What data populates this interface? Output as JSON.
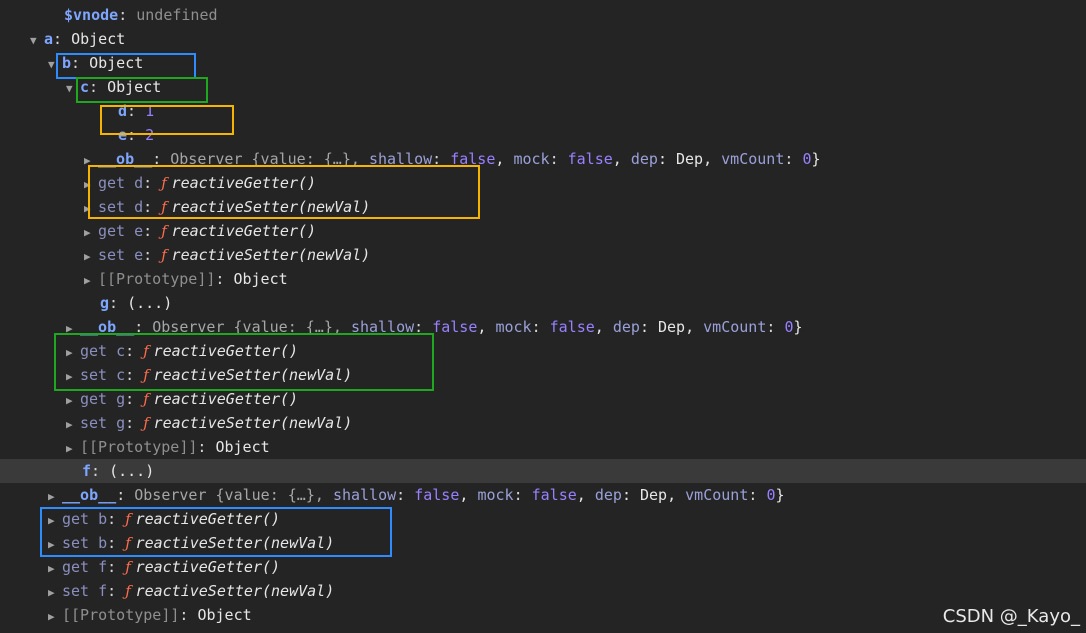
{
  "rows": [
    {
      "indent": 64,
      "tri": "",
      "key": "$vnode",
      "kind": "own",
      "rest": [
        {
          "t": "undefined",
          "c": "undef"
        }
      ]
    },
    {
      "indent": 46,
      "tri": "▼",
      "key": "a",
      "kind": "own",
      "rest": [
        {
          "t": "Object",
          "c": "obj"
        }
      ]
    },
    {
      "indent": 64,
      "tri": "▼",
      "key": "b",
      "kind": "own",
      "rest": [
        {
          "t": "Object",
          "c": "obj"
        }
      ]
    },
    {
      "indent": 82,
      "tri": "▼",
      "key": "c",
      "kind": "own",
      "rest": [
        {
          "t": "Object",
          "c": "obj"
        }
      ]
    },
    {
      "indent": 118,
      "tri": "",
      "key": "d",
      "kind": "own",
      "rest": [
        {
          "t": "1",
          "c": "num"
        }
      ]
    },
    {
      "indent": 118,
      "tri": "",
      "key": "e",
      "kind": "own",
      "rest": [
        {
          "t": "2",
          "c": "num"
        }
      ]
    },
    {
      "indent": 100,
      "tri": "▶",
      "key": "__ob__",
      "kind": "own",
      "rest": [
        {
          "t": "Observer  {value: {…}, ",
          "c": "obsv"
        },
        {
          "t": "shallow",
          "c": "key"
        },
        {
          "t": ": ",
          "c": "colon"
        },
        {
          "t": "false",
          "c": "bool"
        },
        {
          "t": ", ",
          "c": "val"
        },
        {
          "t": "mock",
          "c": "key"
        },
        {
          "t": ": ",
          "c": "colon"
        },
        {
          "t": "false",
          "c": "bool"
        },
        {
          "t": ", ",
          "c": "val"
        },
        {
          "t": "dep",
          "c": "key"
        },
        {
          "t": ": Dep, ",
          "c": "val"
        },
        {
          "t": "vmCount",
          "c": "key"
        },
        {
          "t": ": ",
          "c": "colon"
        },
        {
          "t": "0",
          "c": "num"
        },
        {
          "t": "}",
          "c": "val"
        }
      ]
    },
    {
      "indent": 100,
      "tri": "▶",
      "key": "get d",
      "kind": "dim",
      "rest": [
        {
          "t": "ƒ ",
          "c": "fsym"
        },
        {
          "t": "reactiveGetter()",
          "c": "fname"
        }
      ]
    },
    {
      "indent": 100,
      "tri": "▶",
      "key": "set d",
      "kind": "dim",
      "rest": [
        {
          "t": "ƒ ",
          "c": "fsym"
        },
        {
          "t": "reactiveSetter(newVal)",
          "c": "fname"
        }
      ]
    },
    {
      "indent": 100,
      "tri": "▶",
      "key": "get e",
      "kind": "dim",
      "rest": [
        {
          "t": "ƒ ",
          "c": "fsym"
        },
        {
          "t": "reactiveGetter()",
          "c": "fname"
        }
      ]
    },
    {
      "indent": 100,
      "tri": "▶",
      "key": "set e",
      "kind": "dim",
      "rest": [
        {
          "t": "ƒ ",
          "c": "fsym"
        },
        {
          "t": "reactiveSetter(newVal)",
          "c": "fname"
        }
      ]
    },
    {
      "indent": 100,
      "tri": "▶",
      "key": "[[Prototype]]",
      "kind": "proto",
      "rest": [
        {
          "t": "Object",
          "c": "obj"
        }
      ]
    },
    {
      "indent": 100,
      "tri": "",
      "key": "g",
      "kind": "own",
      "rest": [
        {
          "t": "(...)",
          "c": "lazy"
        }
      ]
    },
    {
      "indent": 82,
      "tri": "▶",
      "key": "__ob__",
      "kind": "own",
      "rest": [
        {
          "t": "Observer  {value: {…}, ",
          "c": "obsv"
        },
        {
          "t": "shallow",
          "c": "key"
        },
        {
          "t": ": ",
          "c": "colon"
        },
        {
          "t": "false",
          "c": "bool"
        },
        {
          "t": ", ",
          "c": "val"
        },
        {
          "t": "mock",
          "c": "key"
        },
        {
          "t": ": ",
          "c": "colon"
        },
        {
          "t": "false",
          "c": "bool"
        },
        {
          "t": ", ",
          "c": "val"
        },
        {
          "t": "dep",
          "c": "key"
        },
        {
          "t": ": Dep, ",
          "c": "val"
        },
        {
          "t": "vmCount",
          "c": "key"
        },
        {
          "t": ": ",
          "c": "colon"
        },
        {
          "t": "0",
          "c": "num"
        },
        {
          "t": "}",
          "c": "val"
        }
      ]
    },
    {
      "indent": 82,
      "tri": "▶",
      "key": "get c",
      "kind": "dim",
      "rest": [
        {
          "t": "ƒ ",
          "c": "fsym"
        },
        {
          "t": "reactiveGetter()",
          "c": "fname"
        }
      ]
    },
    {
      "indent": 82,
      "tri": "▶",
      "key": "set c",
      "kind": "dim",
      "rest": [
        {
          "t": "ƒ ",
          "c": "fsym"
        },
        {
          "t": "reactiveSetter(newVal)",
          "c": "fname"
        }
      ]
    },
    {
      "indent": 82,
      "tri": "▶",
      "key": "get g",
      "kind": "dim",
      "rest": [
        {
          "t": "ƒ ",
          "c": "fsym"
        },
        {
          "t": "reactiveGetter()",
          "c": "fname"
        }
      ]
    },
    {
      "indent": 82,
      "tri": "▶",
      "key": "set g",
      "kind": "dim",
      "rest": [
        {
          "t": "ƒ ",
          "c": "fsym"
        },
        {
          "t": "reactiveSetter(newVal)",
          "c": "fname"
        }
      ]
    },
    {
      "indent": 82,
      "tri": "▶",
      "key": "[[Prototype]]",
      "kind": "proto",
      "rest": [
        {
          "t": "Object",
          "c": "obj"
        }
      ]
    },
    {
      "indent": 82,
      "tri": "",
      "key": "f",
      "kind": "own",
      "hl": true,
      "rest": [
        {
          "t": "(...)",
          "c": "lazy"
        }
      ]
    },
    {
      "indent": 64,
      "tri": "▶",
      "key": "__ob__",
      "kind": "own",
      "rest": [
        {
          "t": "Observer  {value: {…}, ",
          "c": "obsv"
        },
        {
          "t": "shallow",
          "c": "key"
        },
        {
          "t": ": ",
          "c": "colon"
        },
        {
          "t": "false",
          "c": "bool"
        },
        {
          "t": ", ",
          "c": "val"
        },
        {
          "t": "mock",
          "c": "key"
        },
        {
          "t": ": ",
          "c": "colon"
        },
        {
          "t": "false",
          "c": "bool"
        },
        {
          "t": ", ",
          "c": "val"
        },
        {
          "t": "dep",
          "c": "key"
        },
        {
          "t": ": Dep, ",
          "c": "val"
        },
        {
          "t": "vmCount",
          "c": "key"
        },
        {
          "t": ": ",
          "c": "colon"
        },
        {
          "t": "0",
          "c": "num"
        },
        {
          "t": "}",
          "c": "val"
        }
      ]
    },
    {
      "indent": 64,
      "tri": "▶",
      "key": "get b",
      "kind": "dim",
      "rest": [
        {
          "t": "ƒ ",
          "c": "fsym"
        },
        {
          "t": "reactiveGetter()",
          "c": "fname"
        }
      ]
    },
    {
      "indent": 64,
      "tri": "▶",
      "key": "set b",
      "kind": "dim",
      "rest": [
        {
          "t": "ƒ ",
          "c": "fsym"
        },
        {
          "t": "reactiveSetter(newVal)",
          "c": "fname"
        }
      ]
    },
    {
      "indent": 64,
      "tri": "▶",
      "key": "get f",
      "kind": "dim",
      "rest": [
        {
          "t": "ƒ ",
          "c": "fsym"
        },
        {
          "t": "reactiveGetter()",
          "c": "fname"
        }
      ]
    },
    {
      "indent": 64,
      "tri": "▶",
      "key": "set f",
      "kind": "dim",
      "rest": [
        {
          "t": "ƒ ",
          "c": "fsym"
        },
        {
          "t": "reactiveSetter(newVal)",
          "c": "fname"
        }
      ]
    },
    {
      "indent": 64,
      "tri": "▶",
      "key": "[[Prototype]]",
      "kind": "proto",
      "rest": [
        {
          "t": "Object",
          "c": "obj"
        }
      ]
    }
  ],
  "watermark": "CSDN @_Kayo_",
  "colors": {
    "blue_box": "#2f8cff",
    "green_box": "#1fa81f",
    "yellow_box": "#f5b400",
    "background": "#242424"
  }
}
